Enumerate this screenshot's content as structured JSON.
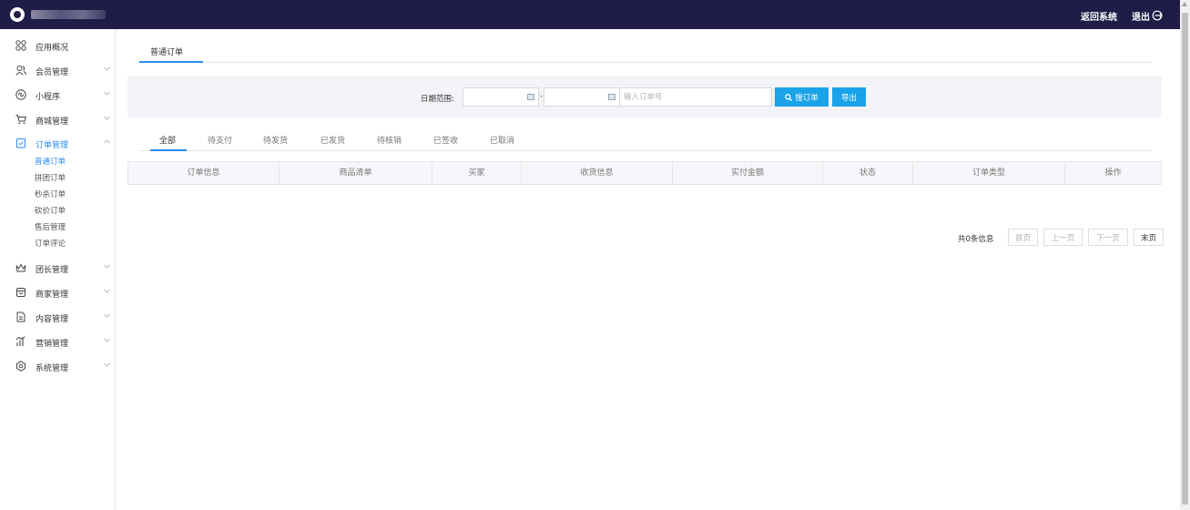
{
  "header": {
    "return_label": "返回系统",
    "logout_label": "退出"
  },
  "sidebar": {
    "items": [
      {
        "label": "应用概况",
        "icon": "dashboard-icon"
      },
      {
        "label": "会员管理",
        "icon": "users-icon"
      },
      {
        "label": "小程序",
        "icon": "miniapp-icon"
      },
      {
        "label": "商城管理",
        "icon": "cart-icon"
      },
      {
        "label": "订单管理",
        "icon": "order-icon",
        "active": true
      },
      {
        "label": "团长管理",
        "icon": "crown-icon"
      },
      {
        "label": "商家管理",
        "icon": "store-icon"
      },
      {
        "label": "内容管理",
        "icon": "document-icon"
      },
      {
        "label": "营销管理",
        "icon": "marketing-icon"
      },
      {
        "label": "系统管理",
        "icon": "settings-icon"
      }
    ],
    "sub_items": [
      "普通订单",
      "拼团订单",
      "秒杀订单",
      "砍价订单",
      "售后管理",
      "订单评论"
    ]
  },
  "main_tab": "普通订单",
  "filter": {
    "date_label": "日期范围:",
    "start_date": "",
    "end_date": "",
    "date_separator": "-",
    "order_placeholder": "输入订单号",
    "search_label": "搜订单",
    "export_label": "导出"
  },
  "status_tabs": [
    "全部",
    "待支付",
    "待发货",
    "已发货",
    "待核销",
    "已签收",
    "已取消"
  ],
  "table": {
    "columns": [
      "订单信息",
      "商品清单",
      "买家",
      "收货信息",
      "实付金额",
      "状态",
      "订单类型",
      "操作"
    ]
  },
  "pagination": {
    "total_text": "共0条信息",
    "first": "首页",
    "prev": "上一页",
    "next": "下一页",
    "last": "末页"
  },
  "colors": {
    "topbar": "#1f1c47",
    "accent": "#2d8cf0",
    "button": "#1aa3e8"
  }
}
